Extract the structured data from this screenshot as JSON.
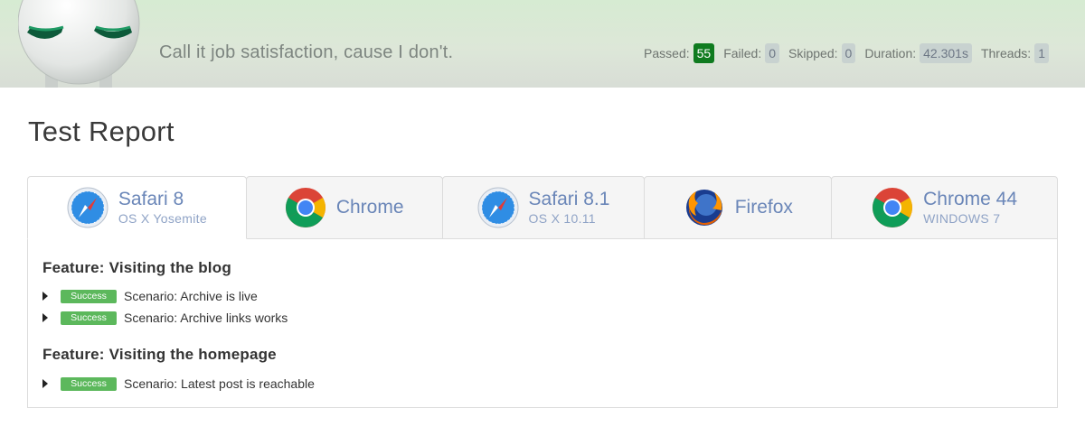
{
  "header": {
    "tagline": "Call it job satisfaction, cause I don't.",
    "stats": [
      {
        "label": "Passed:",
        "value": "55",
        "tone": "ok"
      },
      {
        "label": "Failed:",
        "value": "0",
        "tone": "muted"
      },
      {
        "label": "Skipped:",
        "value": "0",
        "tone": "muted"
      },
      {
        "label": "Duration:",
        "value": "42.301s",
        "tone": "muted"
      },
      {
        "label": "Threads:",
        "value": "1",
        "tone": "muted"
      }
    ]
  },
  "page": {
    "title": "Test Report"
  },
  "tabs": [
    {
      "name": "Safari 8",
      "sub": "OS X Yosemite",
      "icon": "safari-icon",
      "active": true
    },
    {
      "name": "Chrome",
      "sub": "",
      "icon": "chrome-icon",
      "active": false
    },
    {
      "name": "Safari 8.1",
      "sub": "OS X 10.11",
      "icon": "safari-icon",
      "active": false
    },
    {
      "name": "Firefox",
      "sub": "",
      "icon": "firefox-icon",
      "active": false
    },
    {
      "name": "Chrome 44",
      "sub": "WINDOWS 7",
      "icon": "chrome-icon",
      "active": false
    }
  ],
  "features": [
    {
      "title": "Feature: Visiting the blog",
      "scenarios": [
        {
          "status": "Success",
          "text": "Scenario: Archive is live"
        },
        {
          "status": "Success",
          "text": "Scenario: Archive links works"
        }
      ]
    },
    {
      "title": "Feature: Visiting the homepage",
      "scenarios": [
        {
          "status": "Success",
          "text": "Scenario: Latest post is reachable"
        }
      ]
    }
  ],
  "colors": {
    "success": "#5cb85c",
    "passed_badge": "#0f7b1f",
    "tab_text": "#6a86b8"
  }
}
